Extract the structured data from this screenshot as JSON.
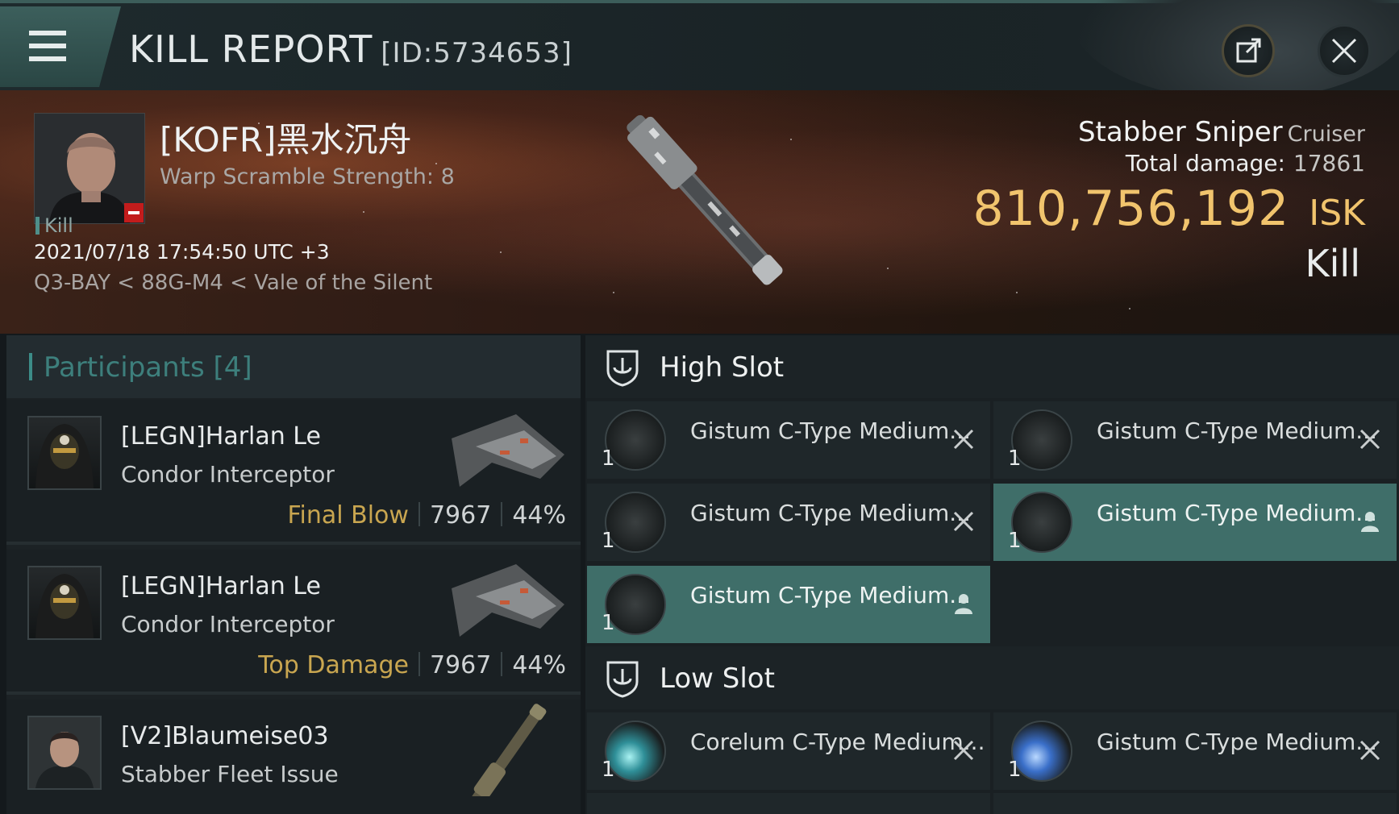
{
  "header": {
    "title": "KILL REPORT",
    "report_id": "[ID:5734653]",
    "menu_icon": "hamburger-icon",
    "share_icon": "external-link-icon",
    "close_icon": "close-icon"
  },
  "victim": {
    "name": "[KOFR]黑水沉舟",
    "warp_scramble": "Warp Scramble Strength: 8",
    "tag": "Kill",
    "datetime": "2021/07/18 17:54:50 UTC +3",
    "location": "Q3-BAY < 88G-M4 < Vale of the Silent",
    "ship_name": "Stabber Sniper",
    "ship_class": "Cruiser",
    "total_damage_label": "Total damage:",
    "total_damage_value": "17861",
    "isk_value": "810,756,192",
    "isk_unit": "ISK",
    "result": "Kill"
  },
  "participants": {
    "title": "Participants",
    "count": "[4]",
    "items": [
      {
        "name": "[LEGN]Harlan Le",
        "ship": "Condor Interceptor",
        "role": "Final Blow",
        "damage": "7967",
        "percent": "44%"
      },
      {
        "name": "[LEGN]Harlan Le",
        "ship": "Condor Interceptor",
        "role": "Top Damage",
        "damage": "7967",
        "percent": "44%"
      },
      {
        "name": "[V2]Blaumeise03",
        "ship": "Stabber Fleet Issue",
        "role": "",
        "damage": "",
        "percent": ""
      }
    ]
  },
  "fitting": {
    "high_slot": {
      "label": "High Slot",
      "modules": [
        {
          "name": "Gistum C-Type Medium...",
          "qty": "1",
          "status": "destroyed"
        },
        {
          "name": "Gistum C-Type Medium...",
          "qty": "1",
          "status": "destroyed"
        },
        {
          "name": "Gistum C-Type Medium...",
          "qty": "1",
          "status": "destroyed"
        },
        {
          "name": "Gistum C-Type Medium...",
          "qty": "1",
          "status": "dropped"
        },
        {
          "name": "Gistum C-Type Medium...",
          "qty": "1",
          "status": "dropped"
        }
      ]
    },
    "low_slot": {
      "label": "Low Slot",
      "modules": [
        {
          "name": "Corelum C-Type Medium...",
          "qty": "1",
          "status": "destroyed"
        },
        {
          "name": "Gistum C-Type Medium...",
          "qty": "1",
          "status": "destroyed"
        }
      ]
    }
  },
  "colors": {
    "accent_teal": "#3f6e69",
    "isk_gold": "#f1c46d",
    "role_gold": "#c9a650",
    "kill_badge_red": "#c21c1c"
  }
}
